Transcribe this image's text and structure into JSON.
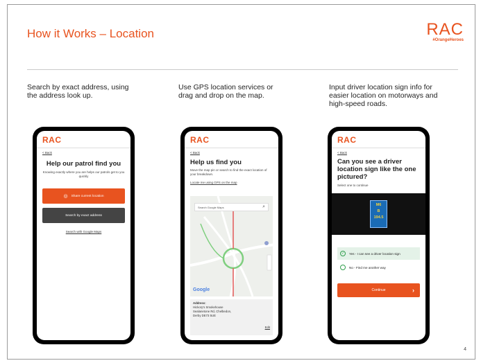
{
  "slide": {
    "title": "How it Works – Location",
    "logo_word": "RAC",
    "logo_tag": "#OrangeHeroes",
    "page_number": "4"
  },
  "columns": [
    {
      "text": "Search by exact address, using the address look up.",
      "phone": {
        "brand": "RAC",
        "back": "< Back",
        "heading": "Help our patrol find you",
        "subtext": "Knowing exactly where you are helps our patrols get to you quickly",
        "btn_primary": "Share current location",
        "btn_secondary": "Search by exact address",
        "link": "Search with Google Maps"
      }
    },
    {
      "text": "Use GPS location services or drag and drop on the map.",
      "phone": {
        "brand": "RAC",
        "back": "< Back",
        "heading": "Help us find you",
        "subtext": "Move the map pin or search to find the exact location of your breakdown.",
        "link": "Locate me using GPS on the map",
        "search_placeholder": "Search Google Maps",
        "map_brand": "Google",
        "address_label": "Address:",
        "address_lines": [
          "Hickory's Smokehouse",
          "Sealanetone Rd, Chelbedon,",
          "Derby DE73 5UE"
        ],
        "edit": "Edit"
      }
    },
    {
      "text": "Input driver location sign info for easier location on motorways and high-speed roads.",
      "phone": {
        "brand": "RAC",
        "back": "< Back",
        "heading": "Can you see a driver location sign like the one pictured?",
        "subtext": "Select one to continue",
        "sign_lines": [
          "M6",
          "B",
          "194.5"
        ],
        "option_yes": "Yes - I can see a driver location sign",
        "option_no": "No - Find me another way",
        "continue": "Continue"
      }
    }
  ],
  "colors": {
    "accent": "#e8531f",
    "dark_button": "#444444",
    "sign_blue": "#1a6bb5",
    "selected_green": "#2f9e4c"
  }
}
